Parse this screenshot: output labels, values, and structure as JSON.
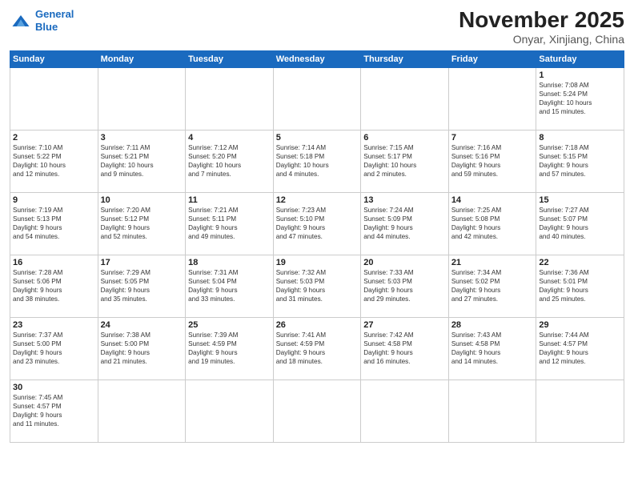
{
  "header": {
    "logo_line1": "General",
    "logo_line2": "Blue",
    "month_title": "November 2025",
    "location": "Onyar, Xinjiang, China"
  },
  "weekdays": [
    "Sunday",
    "Monday",
    "Tuesday",
    "Wednesday",
    "Thursday",
    "Friday",
    "Saturday"
  ],
  "weeks": [
    [
      {
        "day": "",
        "info": ""
      },
      {
        "day": "",
        "info": ""
      },
      {
        "day": "",
        "info": ""
      },
      {
        "day": "",
        "info": ""
      },
      {
        "day": "",
        "info": ""
      },
      {
        "day": "",
        "info": ""
      },
      {
        "day": "1",
        "info": "Sunrise: 7:08 AM\nSunset: 5:24 PM\nDaylight: 10 hours\nand 15 minutes."
      }
    ],
    [
      {
        "day": "2",
        "info": "Sunrise: 7:10 AM\nSunset: 5:22 PM\nDaylight: 10 hours\nand 12 minutes."
      },
      {
        "day": "3",
        "info": "Sunrise: 7:11 AM\nSunset: 5:21 PM\nDaylight: 10 hours\nand 9 minutes."
      },
      {
        "day": "4",
        "info": "Sunrise: 7:12 AM\nSunset: 5:20 PM\nDaylight: 10 hours\nand 7 minutes."
      },
      {
        "day": "5",
        "info": "Sunrise: 7:14 AM\nSunset: 5:18 PM\nDaylight: 10 hours\nand 4 minutes."
      },
      {
        "day": "6",
        "info": "Sunrise: 7:15 AM\nSunset: 5:17 PM\nDaylight: 10 hours\nand 2 minutes."
      },
      {
        "day": "7",
        "info": "Sunrise: 7:16 AM\nSunset: 5:16 PM\nDaylight: 9 hours\nand 59 minutes."
      },
      {
        "day": "8",
        "info": "Sunrise: 7:18 AM\nSunset: 5:15 PM\nDaylight: 9 hours\nand 57 minutes."
      }
    ],
    [
      {
        "day": "9",
        "info": "Sunrise: 7:19 AM\nSunset: 5:13 PM\nDaylight: 9 hours\nand 54 minutes."
      },
      {
        "day": "10",
        "info": "Sunrise: 7:20 AM\nSunset: 5:12 PM\nDaylight: 9 hours\nand 52 minutes."
      },
      {
        "day": "11",
        "info": "Sunrise: 7:21 AM\nSunset: 5:11 PM\nDaylight: 9 hours\nand 49 minutes."
      },
      {
        "day": "12",
        "info": "Sunrise: 7:23 AM\nSunset: 5:10 PM\nDaylight: 9 hours\nand 47 minutes."
      },
      {
        "day": "13",
        "info": "Sunrise: 7:24 AM\nSunset: 5:09 PM\nDaylight: 9 hours\nand 44 minutes."
      },
      {
        "day": "14",
        "info": "Sunrise: 7:25 AM\nSunset: 5:08 PM\nDaylight: 9 hours\nand 42 minutes."
      },
      {
        "day": "15",
        "info": "Sunrise: 7:27 AM\nSunset: 5:07 PM\nDaylight: 9 hours\nand 40 minutes."
      }
    ],
    [
      {
        "day": "16",
        "info": "Sunrise: 7:28 AM\nSunset: 5:06 PM\nDaylight: 9 hours\nand 38 minutes."
      },
      {
        "day": "17",
        "info": "Sunrise: 7:29 AM\nSunset: 5:05 PM\nDaylight: 9 hours\nand 35 minutes."
      },
      {
        "day": "18",
        "info": "Sunrise: 7:31 AM\nSunset: 5:04 PM\nDaylight: 9 hours\nand 33 minutes."
      },
      {
        "day": "19",
        "info": "Sunrise: 7:32 AM\nSunset: 5:03 PM\nDaylight: 9 hours\nand 31 minutes."
      },
      {
        "day": "20",
        "info": "Sunrise: 7:33 AM\nSunset: 5:03 PM\nDaylight: 9 hours\nand 29 minutes."
      },
      {
        "day": "21",
        "info": "Sunrise: 7:34 AM\nSunset: 5:02 PM\nDaylight: 9 hours\nand 27 minutes."
      },
      {
        "day": "22",
        "info": "Sunrise: 7:36 AM\nSunset: 5:01 PM\nDaylight: 9 hours\nand 25 minutes."
      }
    ],
    [
      {
        "day": "23",
        "info": "Sunrise: 7:37 AM\nSunset: 5:00 PM\nDaylight: 9 hours\nand 23 minutes."
      },
      {
        "day": "24",
        "info": "Sunrise: 7:38 AM\nSunset: 5:00 PM\nDaylight: 9 hours\nand 21 minutes."
      },
      {
        "day": "25",
        "info": "Sunrise: 7:39 AM\nSunset: 4:59 PM\nDaylight: 9 hours\nand 19 minutes."
      },
      {
        "day": "26",
        "info": "Sunrise: 7:41 AM\nSunset: 4:59 PM\nDaylight: 9 hours\nand 18 minutes."
      },
      {
        "day": "27",
        "info": "Sunrise: 7:42 AM\nSunset: 4:58 PM\nDaylight: 9 hours\nand 16 minutes."
      },
      {
        "day": "28",
        "info": "Sunrise: 7:43 AM\nSunset: 4:58 PM\nDaylight: 9 hours\nand 14 minutes."
      },
      {
        "day": "29",
        "info": "Sunrise: 7:44 AM\nSunset: 4:57 PM\nDaylight: 9 hours\nand 12 minutes."
      }
    ],
    [
      {
        "day": "30",
        "info": "Sunrise: 7:45 AM\nSunset: 4:57 PM\nDaylight: 9 hours\nand 11 minutes."
      },
      {
        "day": "",
        "info": ""
      },
      {
        "day": "",
        "info": ""
      },
      {
        "day": "",
        "info": ""
      },
      {
        "day": "",
        "info": ""
      },
      {
        "day": "",
        "info": ""
      },
      {
        "day": "",
        "info": ""
      }
    ]
  ]
}
